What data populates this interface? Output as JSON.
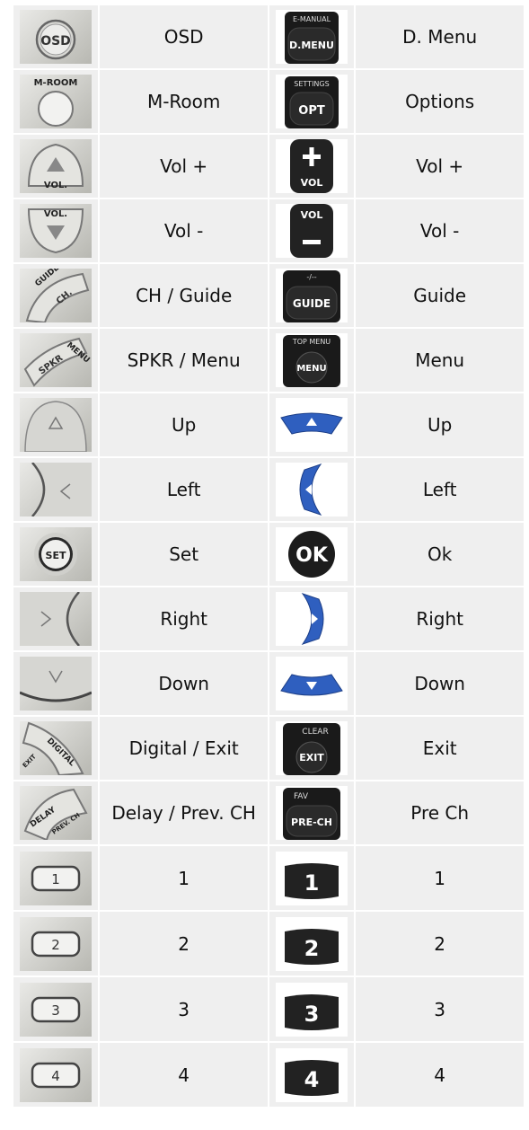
{
  "rows": [
    {
      "left_label": "OSD",
      "right_label": "D. Menu",
      "left_icon": "osd-button-icon",
      "right_icon": "dmenu-button-icon",
      "left_caption": "OSD",
      "right_caption_top": "E-MANUAL",
      "right_caption": "D.MENU"
    },
    {
      "left_label": "M-Room",
      "right_label": "Options",
      "left_icon": "m-room-button-icon",
      "right_icon": "opt-button-icon",
      "left_caption": "M-ROOM",
      "right_caption_top": "SETTINGS",
      "right_caption": "OPT"
    },
    {
      "left_label": "Vol +",
      "right_label": "Vol +",
      "left_icon": "vol-up-button-icon",
      "right_icon": "vol-plus-button-icon",
      "left_caption": "VOL.",
      "right_caption": "VOL"
    },
    {
      "left_label": "Vol -",
      "right_label": "Vol -",
      "left_icon": "vol-down-button-icon",
      "right_icon": "vol-minus-button-icon",
      "left_caption": "VOL.",
      "right_caption": "VOL"
    },
    {
      "left_label": "CH / Guide",
      "right_label": "Guide",
      "left_icon": "ch-guide-button-icon",
      "right_icon": "guide-button-icon",
      "left_caption": "CH.",
      "left_caption_top": "GUIDE",
      "right_caption_top": "-/--",
      "right_caption": "GUIDE"
    },
    {
      "left_label": "SPKR / Menu",
      "right_label": "Menu",
      "left_icon": "spkr-menu-button-icon",
      "right_icon": "menu-button-icon",
      "left_caption": "SPKR",
      "left_caption_top": "MENU",
      "right_caption_top": "TOP MENU",
      "right_caption": "MENU"
    },
    {
      "left_label": "Up",
      "right_label": "Up",
      "left_icon": "up-arrow-button-icon",
      "right_icon": "up-arrow-blue-icon"
    },
    {
      "left_label": "Left",
      "right_label": "Left",
      "left_icon": "left-arrow-button-icon",
      "right_icon": "left-arrow-blue-icon"
    },
    {
      "left_label": "Set",
      "right_label": "Ok",
      "left_icon": "set-button-icon",
      "right_icon": "ok-button-icon",
      "left_caption": "SET",
      "right_caption": "OK"
    },
    {
      "left_label": "Right",
      "right_label": "Right",
      "left_icon": "right-arrow-button-icon",
      "right_icon": "right-arrow-blue-icon"
    },
    {
      "left_label": "Down",
      "right_label": "Down",
      "left_icon": "down-arrow-button-icon",
      "right_icon": "down-arrow-blue-icon"
    },
    {
      "left_label": "Digital / Exit",
      "right_label": "Exit",
      "left_icon": "digital-exit-button-icon",
      "right_icon": "exit-button-icon",
      "left_caption": "DIGITAL",
      "left_caption_top": "EXIT",
      "right_caption_top": "CLEAR",
      "right_caption": "EXIT"
    },
    {
      "left_label": "Delay / Prev. CH",
      "right_label": "Pre Ch",
      "left_icon": "delay-prevch-button-icon",
      "right_icon": "pre-ch-button-icon",
      "left_caption": "DELAY",
      "left_caption_top": "PREV. CH",
      "right_caption_top": "FAV",
      "right_caption": "PRE-CH"
    },
    {
      "left_label": "1",
      "right_label": "1",
      "left_icon": "digit-1-button-icon",
      "right_icon": "digit-1-black-icon",
      "left_caption": "1",
      "right_caption": "1"
    },
    {
      "left_label": "2",
      "right_label": "2",
      "left_icon": "digit-2-button-icon",
      "right_icon": "digit-2-black-icon",
      "left_caption": "2",
      "right_caption": "2"
    },
    {
      "left_label": "3",
      "right_label": "3",
      "left_icon": "digit-3-button-icon",
      "right_icon": "digit-3-black-icon",
      "left_caption": "3",
      "right_caption": "3"
    },
    {
      "left_label": "4",
      "right_label": "4",
      "left_icon": "digit-4-button-icon",
      "right_icon": "digit-4-black-icon",
      "left_caption": "4",
      "right_caption": "4"
    }
  ],
  "colors": {
    "cell_bg": "#efefef",
    "silver": "#c9c9c4",
    "remote_black": "#222222",
    "accent_blue": "#2f5fbf"
  }
}
